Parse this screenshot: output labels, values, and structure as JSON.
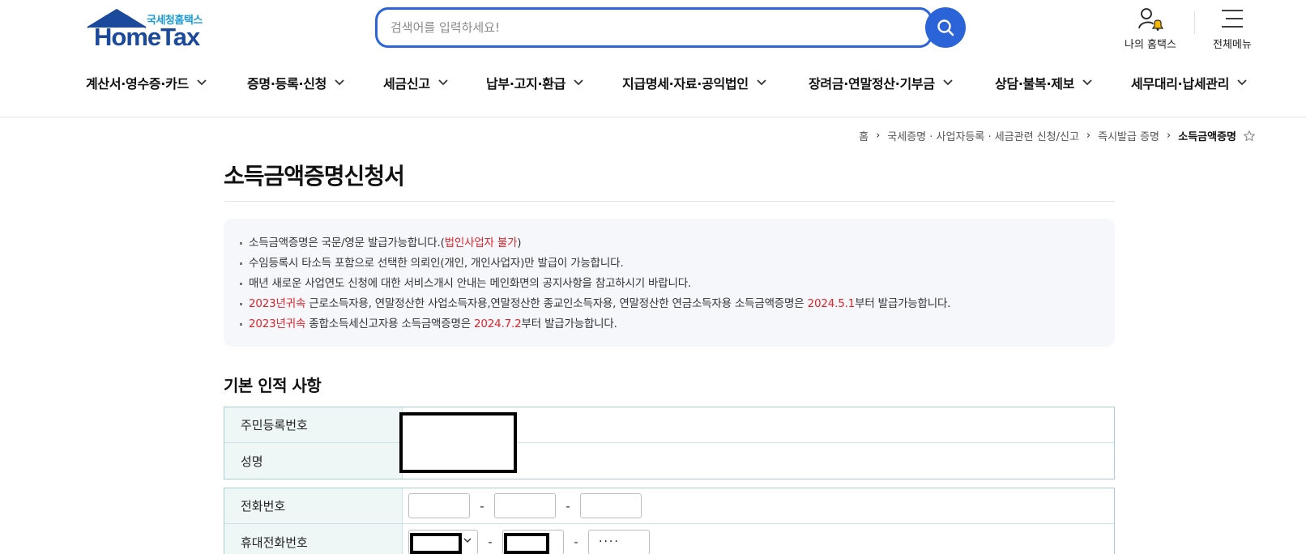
{
  "header": {
    "logo_sub": "국세청홈택스",
    "logo_main": "HomeTax",
    "search_placeholder": "검색어를 입력하세요!",
    "my_hometax": "나의 홈택스",
    "all_menu": "전체메뉴"
  },
  "gnb": [
    "계산서·영수증·카드",
    "증명·등록·신청",
    "세금신고",
    "납부·고지·환급",
    "지급명세·자료·공익법인",
    "장려금·연말정산·기부금",
    "상담·불복·제보",
    "세무대리·납세관리"
  ],
  "breadcrumb": {
    "home": "홈",
    "level1": "국세증명 · 사업자등록 · 세금관련 신청/신고",
    "level2": "즉시발급 증명",
    "current": "소득금액증명"
  },
  "page_title": "소득금액증명신청서",
  "notices": {
    "n1_text": "소득금액증명은 국문/영문 발급가능합니다.(",
    "n1_red": "법인사업자 불가",
    "n1_end": ")",
    "n2": "수임등록시 타소득 포함으로 선택한 의뢰인(개인, 개인사업자)만 발급이 가능합니다.",
    "n3": "매년 새로운 사업연도 신청에 대한 서비스개시 안내는 메인화면의 공지사항을 참고하시기 바랍니다.",
    "n4_red1": "2023년귀속",
    "n4_text": " 근로소득자용, 연말정산한 사업소득자용,연말정산한 종교인소득자용, 연말정산한 연금소득자용 소득금액증명은 ",
    "n4_red2": "2024.5.1",
    "n4_end": "부터 발급가능합니다.",
    "n5_red1": "2023년귀속",
    "n5_text": " 종합소득세신고자용 소득금액증명은 ",
    "n5_red2": "2024.7.2",
    "n5_end": "부터 발급가능합니다."
  },
  "section": {
    "title": "기본 인적 사항",
    "resident_number_label": "주민등록번호",
    "name_label": "성명",
    "phone_label": "전화번호",
    "mobile_label": "휴대전화번호",
    "dash": "-",
    "mobile_masked": "····"
  }
}
